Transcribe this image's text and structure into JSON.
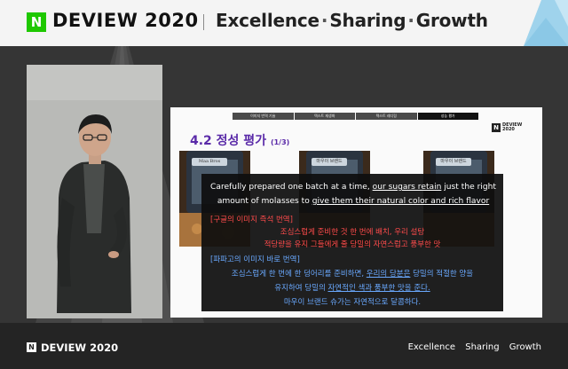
{
  "header": {
    "logo_letter": "N",
    "brand": "DEVIEW 2020",
    "tagline": [
      "Excellence",
      "Sharing",
      "Growth"
    ],
    "tagline_separator": "·",
    "accent_color": "#1ec800"
  },
  "slide": {
    "tabs": [
      {
        "label": "이미지 번역 기술",
        "active": false
      },
      {
        "label": "텍스트 재생화",
        "active": false
      },
      {
        "label": "텍스트 레디링",
        "active": false
      },
      {
        "label": "성능 평가",
        "active": true
      }
    ],
    "logo_letter": "N",
    "logo_text_line1": "DEVIEW",
    "logo_text_line2": "2020",
    "title": "4.2 정성 평가",
    "title_sub": "(1/3)",
    "title_color": "#5a2aa8",
    "photo_labels": [
      "Maa Bros",
      "마우이 브랜드",
      "마우이 브랜드"
    ],
    "subtitles": {
      "en_part1": "Carefully prepared one batch at a time, ",
      "en_u1": "our sugars retain",
      "en_part2": " just the right amount of molasses to ",
      "en_u2": "give them their natural color and rich flavor",
      "google_head": "[구글의 이미지 즉석 번역]",
      "google_line1": "조심스럽게 준비한 것 한 번에 배치, 우리 설탕",
      "google_line2": "적당량을 유지 그들에게 줄 당밀의 자연스럽고 풍부한 맛",
      "papago_head": "[파파고의 이미지 바로 번역]",
      "papago_line1_a": "조심스럽게 한 번에 한 덩어리를 준비하면, ",
      "papago_line1_u": "우리의 당분은",
      "papago_line1_b": " 당밀의 적절한 양을",
      "papago_line2_a": "유지하여 당밀의 ",
      "papago_line2_u": "자연적인 색과 풍부한 맛을 준다.",
      "papago_line3": "마우이 브랜드 슈가는 자연적으로 달콤하다.",
      "google_color": "#ff4b4b",
      "papago_color": "#6aa9ff"
    }
  },
  "footer": {
    "logo_letter": "N",
    "brand": "DEVIEW 2020",
    "tags": [
      "Excellence",
      "Sharing",
      "Growth"
    ]
  }
}
